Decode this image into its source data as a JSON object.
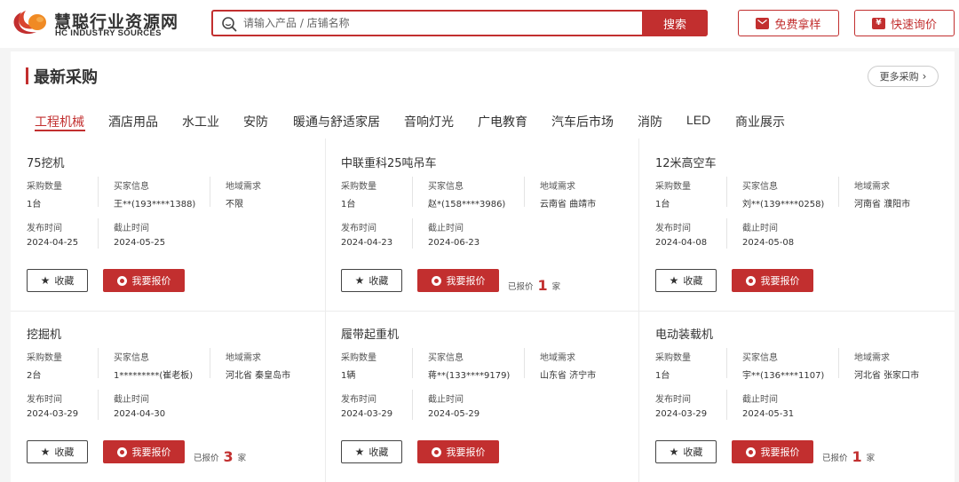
{
  "brand": {
    "name_cn": "慧聪行业资源网",
    "name_en": "HC INDUSTRY SOURCES"
  },
  "search": {
    "placeholder": "请输入产品 / 店铺名称",
    "button_label": "搜索"
  },
  "header_buttons": {
    "free_sample": "免费拿样",
    "quick_inquiry": "快速询价",
    "inquiry_icon_glyph": "¥"
  },
  "section": {
    "title": "最新采购",
    "more_label": "更多采购"
  },
  "tabs": [
    {
      "label": "工程机械",
      "active": true
    },
    {
      "label": "酒店用品"
    },
    {
      "label": "水工业"
    },
    {
      "label": "安防"
    },
    {
      "label": "暖通与舒适家居"
    },
    {
      "label": "音响灯光"
    },
    {
      "label": "广电教育"
    },
    {
      "label": "汽车后市场"
    },
    {
      "label": "消防"
    },
    {
      "label": "LED"
    },
    {
      "label": "商业展示"
    }
  ],
  "field_labels": {
    "quantity": "采购数量",
    "buyer": "买家信息",
    "region": "地域需求",
    "published": "发布时间",
    "deadline": "截止时间"
  },
  "actions": {
    "favorite": "收藏",
    "quote": "我要报价",
    "quoted_prefix": "已报价",
    "quoted_suffix": "家"
  },
  "cards": [
    {
      "title": "75挖机",
      "quantity": "1台",
      "buyer": "王**(193****1388)",
      "region": "不限",
      "published": "2024-04-25",
      "deadline": "2024-05-25",
      "quoted": null
    },
    {
      "title": "中联重科25吨吊车",
      "quantity": "1台",
      "buyer": "赵*(158****3986)",
      "region": "云南省  曲靖市",
      "published": "2024-04-23",
      "deadline": "2024-06-23",
      "quoted": "1"
    },
    {
      "title": "12米高空车",
      "quantity": "1台",
      "buyer": "刘**(139****0258)",
      "region": "河南省  濮阳市",
      "published": "2024-04-08",
      "deadline": "2024-05-08",
      "quoted": null
    },
    {
      "title": "挖掘机",
      "quantity": "2台",
      "buyer": "1*********(崔老板)",
      "region": "河北省  秦皇岛市",
      "published": "2024-03-29",
      "deadline": "2024-04-30",
      "quoted": "3"
    },
    {
      "title": "履带起重机",
      "quantity": "1辆",
      "buyer": "蒋**(133****9179)",
      "region": "山东省  济宁市",
      "published": "2024-03-29",
      "deadline": "2024-05-29",
      "quoted": null
    },
    {
      "title": "电动装载机",
      "quantity": "1台",
      "buyer": "宇**(136****1107)",
      "region": "河北省  张家口市",
      "published": "2024-03-29",
      "deadline": "2024-05-31",
      "quoted": "1"
    }
  ],
  "colors": {
    "accent": "#c22f2f",
    "logo_orange": "#f08a24"
  }
}
